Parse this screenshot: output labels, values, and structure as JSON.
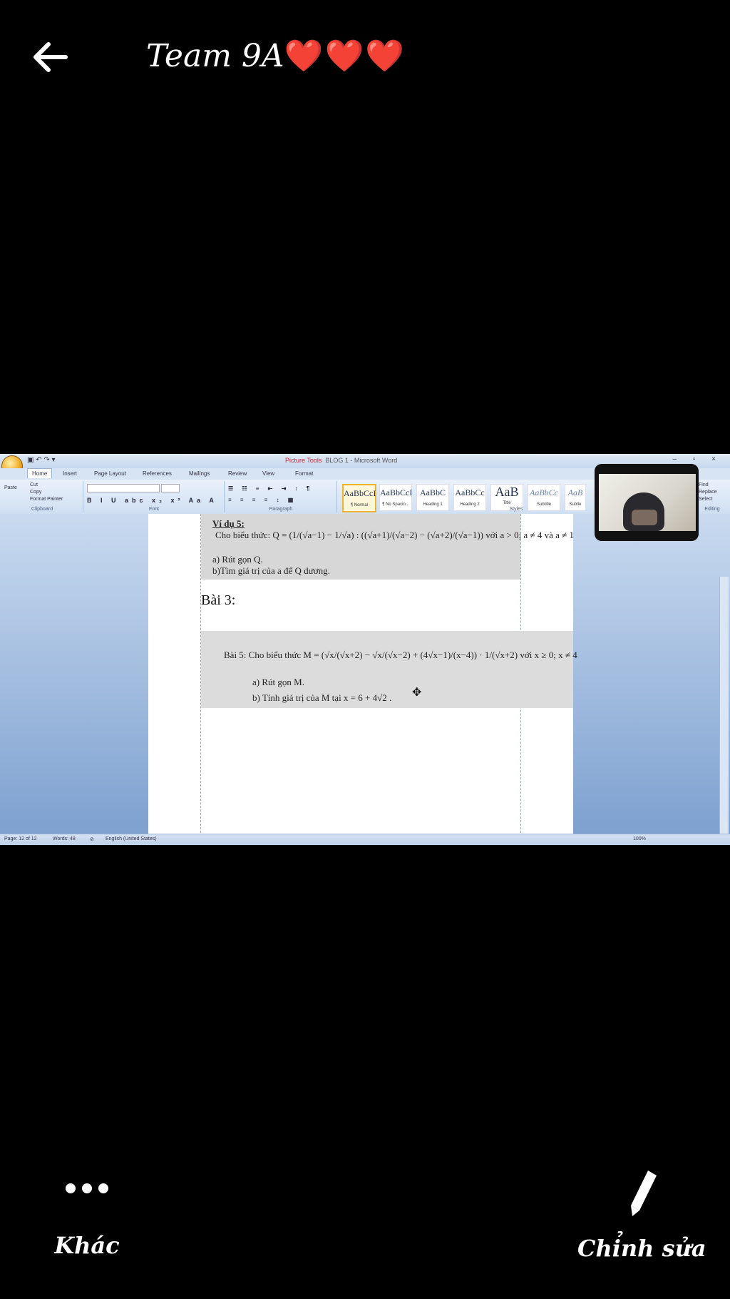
{
  "header": {
    "title": "Team 9A",
    "hearts": "❤️❤️❤️"
  },
  "word": {
    "title_bar": {
      "context_tab": "Picture Tools",
      "document_title": "BLOG 1 - Microsoft Word"
    },
    "tabs": [
      "Home",
      "Insert",
      "Page Layout",
      "References",
      "Mailings",
      "Review",
      "View",
      "Format"
    ],
    "ribbon": {
      "clipboard": {
        "paste": "Paste",
        "cut": "Cut",
        "copy": "Copy",
        "format_painter": "Format Painter",
        "caption": "Clipboard"
      },
      "font_caption": "Font",
      "paragraph_caption": "Paragraph",
      "styles_caption": "Styles",
      "editing_caption": "Editing",
      "editing_items": [
        "Find",
        "Replace",
        "Select"
      ],
      "styles": [
        {
          "sample": "AaBbCcI",
          "name": "¶ Normal"
        },
        {
          "sample": "AaBbCcI",
          "name": "¶ No Spacin..."
        },
        {
          "sample": "AaBbC",
          "name": "Heading 1"
        },
        {
          "sample": "AaBbCc",
          "name": "Heading 2"
        },
        {
          "sample": "AaB",
          "name": "Title"
        },
        {
          "sample": "AaBbCc",
          "name": "Subtitle"
        },
        {
          "sample": "AaB",
          "name": "Subtle"
        }
      ]
    },
    "document": {
      "example_heading": "Ví dụ 5:",
      "example_line": "Cho biểu thức: Q = (1/(√a−1) − 1/√a) : ((√a+1)/(√a−2) − (√a+2)/(√a−1))   với  a > 0; a ≠ 4 và a ≠ 1",
      "example_a": "a) Rút gọn Q.",
      "example_b": "b)Tìm giá trị của a để Q dương.",
      "section": "Bài 3:",
      "bai5_line": "Bài 5:  Cho biểu thức   M = (√x/(√x+2) − √x/(√x−2) + (4√x−1)/(x−4)) · 1/(√x+2)        với  x ≥ 0; x ≠ 4",
      "bai5_a": "a) Rút gọn M.",
      "bai5_b": "b) Tính giá trị của M tại  x = 6 + 4√2 ."
    },
    "status_bar": {
      "page": "Page: 12 of 12",
      "words": "Words: 48",
      "language": "English (United States)",
      "zoom": "100%"
    }
  },
  "actions": {
    "more_label": "Khác",
    "edit_label": "Chỉnh sửa"
  }
}
